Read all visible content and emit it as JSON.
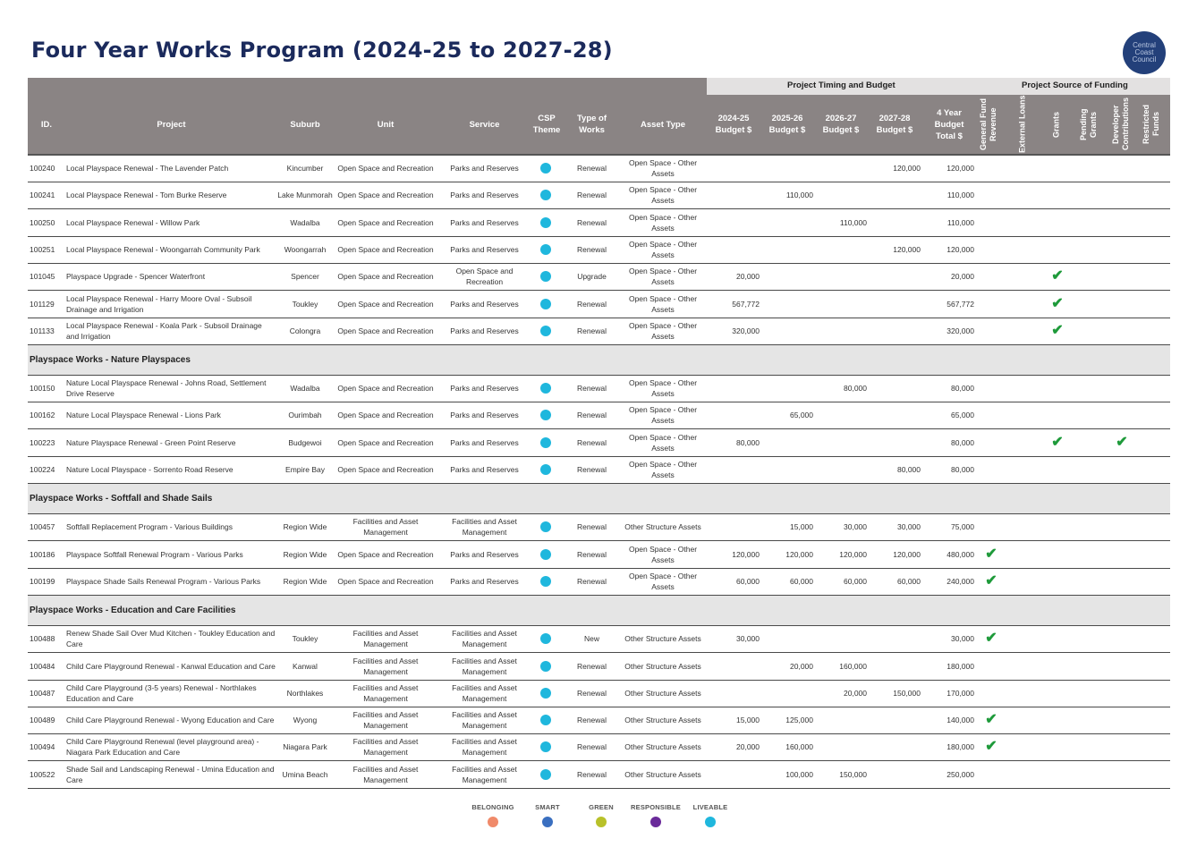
{
  "title": "Four Year Works Program (2024-25 to 2027-28)",
  "logo_text": "Central Coast Council",
  "groups": {
    "timing": "Project Timing and Budget",
    "funding": "Project Source of Funding"
  },
  "headers": {
    "id": "ID.",
    "project": "Project",
    "suburb": "Suburb",
    "unit": "Unit",
    "service": "Service",
    "csp": "CSP Theme",
    "type": "Type of Works",
    "asset": "Asset Type",
    "b1": "2024-25 Budget $",
    "b2": "2025-26 Budget $",
    "b3": "2026-27 Budget $",
    "b4": "2027-28 Budget $",
    "total": "4 Year Budget Total $",
    "f1": "General Fund Revenue",
    "f2": "External Loans",
    "f3": "Grants",
    "f4": "Pending Grants",
    "f5": "Developer Contributions",
    "f6": "Restricted Funds"
  },
  "rows": [
    {
      "id": "100240",
      "project": "Local Playspace Renewal - The Lavender Patch",
      "suburb": "Kincumber",
      "unit": "Open Space and Recreation",
      "service": "Parks and Reserves",
      "type": "Renewal",
      "asset": "Open Space - Other Assets",
      "b1": "",
      "b2": "",
      "b3": "",
      "b4": "120,000",
      "total": "120,000",
      "gf": "",
      "gr": "",
      "dc": ""
    },
    {
      "id": "100241",
      "project": "Local Playspace Renewal - Tom Burke Reserve",
      "suburb": "Lake Munmorah",
      "unit": "Open Space and Recreation",
      "service": "Parks and Reserves",
      "type": "Renewal",
      "asset": "Open Space - Other Assets",
      "b1": "",
      "b2": "110,000",
      "b3": "",
      "b4": "",
      "total": "110,000",
      "gf": "",
      "gr": "",
      "dc": ""
    },
    {
      "id": "100250",
      "project": "Local Playspace Renewal - Willow Park",
      "suburb": "Wadalba",
      "unit": "Open Space and Recreation",
      "service": "Parks and Reserves",
      "type": "Renewal",
      "asset": "Open Space - Other Assets",
      "b1": "",
      "b2": "",
      "b3": "110,000",
      "b4": "",
      "total": "110,000",
      "gf": "",
      "gr": "",
      "dc": ""
    },
    {
      "id": "100251",
      "project": "Local Playspace Renewal - Woongarrah Community Park",
      "suburb": "Woongarrah",
      "unit": "Open Space and Recreation",
      "service": "Parks and Reserves",
      "type": "Renewal",
      "asset": "Open Space - Other Assets",
      "b1": "",
      "b2": "",
      "b3": "",
      "b4": "120,000",
      "total": "120,000",
      "gf": "",
      "gr": "",
      "dc": ""
    },
    {
      "id": "101045",
      "project": "Playspace Upgrade - Spencer Waterfront",
      "suburb": "Spencer",
      "unit": "Open Space and Recreation",
      "service": "Open Space and Recreation",
      "type": "Upgrade",
      "asset": "Open Space - Other Assets",
      "b1": "20,000",
      "b2": "",
      "b3": "",
      "b4": "",
      "total": "20,000",
      "gf": "",
      "gr": "✔",
      "dc": ""
    },
    {
      "id": "101129",
      "project": "Local Playspace Renewal - Harry Moore Oval - Subsoil Drainage and Irrigation",
      "suburb": "Toukley",
      "unit": "Open Space and Recreation",
      "service": "Parks and Reserves",
      "type": "Renewal",
      "asset": "Open Space - Other Assets",
      "b1": "567,772",
      "b2": "",
      "b3": "",
      "b4": "",
      "total": "567,772",
      "gf": "",
      "gr": "✔",
      "dc": ""
    },
    {
      "id": "101133",
      "project": "Local Playspace Renewal - Koala Park - Subsoil Drainage and Irrigation",
      "suburb": "Colongra",
      "unit": "Open Space and Recreation",
      "service": "Parks and Reserves",
      "type": "Renewal",
      "asset": "Open Space - Other Assets",
      "b1": "320,000",
      "b2": "",
      "b3": "",
      "b4": "",
      "total": "320,000",
      "gf": "",
      "gr": "✔",
      "dc": ""
    },
    {
      "section": "Playspace Works - Nature Playspaces"
    },
    {
      "id": "100150",
      "project": "Nature Local Playspace Renewal - Johns Road, Settlement Drive Reserve",
      "suburb": "Wadalba",
      "unit": "Open Space and Recreation",
      "service": "Parks and Reserves",
      "type": "Renewal",
      "asset": "Open Space - Other Assets",
      "b1": "",
      "b2": "",
      "b3": "80,000",
      "b4": "",
      "total": "80,000",
      "gf": "",
      "gr": "",
      "dc": ""
    },
    {
      "id": "100162",
      "project": "Nature Local Playspace Renewal - Lions Park",
      "suburb": "Ourimbah",
      "unit": "Open Space and Recreation",
      "service": "Parks and Reserves",
      "type": "Renewal",
      "asset": "Open Space - Other Assets",
      "b1": "",
      "b2": "65,000",
      "b3": "",
      "b4": "",
      "total": "65,000",
      "gf": "",
      "gr": "",
      "dc": ""
    },
    {
      "id": "100223",
      "project": "Nature Playspace Renewal - Green Point Reserve",
      "suburb": "Budgewoi",
      "unit": "Open Space and Recreation",
      "service": "Parks and Reserves",
      "type": "Renewal",
      "asset": "Open Space - Other Assets",
      "b1": "80,000",
      "b2": "",
      "b3": "",
      "b4": "",
      "total": "80,000",
      "gf": "",
      "gr": "✔",
      "dc": "✔"
    },
    {
      "id": "100224",
      "project": "Nature Local Playspace - Sorrento Road Reserve",
      "suburb": "Empire Bay",
      "unit": "Open Space and Recreation",
      "service": "Parks and Reserves",
      "type": "Renewal",
      "asset": "Open Space - Other Assets",
      "b1": "",
      "b2": "",
      "b3": "",
      "b4": "80,000",
      "total": "80,000",
      "gf": "",
      "gr": "",
      "dc": ""
    },
    {
      "section": "Playspace Works - Softfall and Shade Sails"
    },
    {
      "id": "100457",
      "project": "Softfall Replacement Program - Various Buildings",
      "suburb": "Region Wide",
      "unit": "Facilities and Asset Management",
      "service": "Facilities and Asset Management",
      "type": "Renewal",
      "asset": "Other Structure Assets",
      "b1": "",
      "b2": "15,000",
      "b3": "30,000",
      "b4": "30,000",
      "total": "75,000",
      "gf": "",
      "gr": "",
      "dc": ""
    },
    {
      "id": "100186",
      "project": "Playspace Softfall Renewal Program - Various Parks",
      "suburb": "Region Wide",
      "unit": "Open Space and Recreation",
      "service": "Parks and Reserves",
      "type": "Renewal",
      "asset": "Open Space - Other Assets",
      "b1": "120,000",
      "b2": "120,000",
      "b3": "120,000",
      "b4": "120,000",
      "total": "480,000",
      "gf": "✔",
      "gr": "",
      "dc": ""
    },
    {
      "id": "100199",
      "project": "Playspace Shade Sails Renewal Program - Various Parks",
      "suburb": "Region Wide",
      "unit": "Open Space and Recreation",
      "service": "Parks and Reserves",
      "type": "Renewal",
      "asset": "Open Space - Other Assets",
      "b1": "60,000",
      "b2": "60,000",
      "b3": "60,000",
      "b4": "60,000",
      "total": "240,000",
      "gf": "✔",
      "gr": "",
      "dc": ""
    },
    {
      "section": "Playspace Works - Education and Care Facilities"
    },
    {
      "id": "100488",
      "project": "Renew Shade Sail Over Mud Kitchen - Toukley Education and Care",
      "suburb": "Toukley",
      "unit": "Facilities and Asset Management",
      "service": "Facilities and Asset Management",
      "type": "New",
      "asset": "Other Structure Assets",
      "b1": "30,000",
      "b2": "",
      "b3": "",
      "b4": "",
      "total": "30,000",
      "gf": "✔",
      "gr": "",
      "dc": ""
    },
    {
      "id": "100484",
      "project": "Child Care Playground Renewal - Kanwal Education and Care",
      "suburb": "Kanwal",
      "unit": "Facilities and Asset Management",
      "service": "Facilities and Asset Management",
      "type": "Renewal",
      "asset": "Other Structure Assets",
      "b1": "",
      "b2": "20,000",
      "b3": "160,000",
      "b4": "",
      "total": "180,000",
      "gf": "",
      "gr": "",
      "dc": ""
    },
    {
      "id": "100487",
      "project": "Child Care Playground (3-5 years) Renewal - Northlakes Education and Care",
      "suburb": "Northlakes",
      "unit": "Facilities and Asset Management",
      "service": "Facilities and Asset Management",
      "type": "Renewal",
      "asset": "Other Structure Assets",
      "b1": "",
      "b2": "",
      "b3": "20,000",
      "b4": "150,000",
      "total": "170,000",
      "gf": "",
      "gr": "",
      "dc": ""
    },
    {
      "id": "100489",
      "project": "Child Care Playground Renewal - Wyong Education and Care",
      "suburb": "Wyong",
      "unit": "Facilities and Asset Management",
      "service": "Facilities and Asset Management",
      "type": "Renewal",
      "asset": "Other Structure Assets",
      "b1": "15,000",
      "b2": "125,000",
      "b3": "",
      "b4": "",
      "total": "140,000",
      "gf": "✔",
      "gr": "",
      "dc": ""
    },
    {
      "id": "100494",
      "project": "Child Care Playground Renewal (level playground area) - Niagara Park Education and Care",
      "suburb": "Niagara Park",
      "unit": "Facilities and Asset Management",
      "service": "Facilities and Asset Management",
      "type": "Renewal",
      "asset": "Other Structure Assets",
      "b1": "20,000",
      "b2": "160,000",
      "b3": "",
      "b4": "",
      "total": "180,000",
      "gf": "✔",
      "gr": "",
      "dc": ""
    },
    {
      "id": "100522",
      "project": "Shade Sail and Landscaping Renewal - Umina Education and Care",
      "suburb": "Umina Beach",
      "unit": "Facilities and Asset Management",
      "service": "Facilities and Asset Management",
      "type": "Renewal",
      "asset": "Other Structure Assets",
      "b1": "",
      "b2": "100,000",
      "b3": "150,000",
      "b4": "",
      "total": "250,000",
      "gf": "",
      "gr": "",
      "dc": ""
    }
  ],
  "csp_color": "#1fb7dd",
  "legend": [
    {
      "label": "BELONGING",
      "color": "#f08a6a"
    },
    {
      "label": "SMART",
      "color": "#3a6fc0"
    },
    {
      "label": "GREEN",
      "color": "#b8c12a"
    },
    {
      "label": "RESPONSIBLE",
      "color": "#6a2a9a"
    },
    {
      "label": "LIVEABLE",
      "color": "#1fb7dd"
    }
  ]
}
